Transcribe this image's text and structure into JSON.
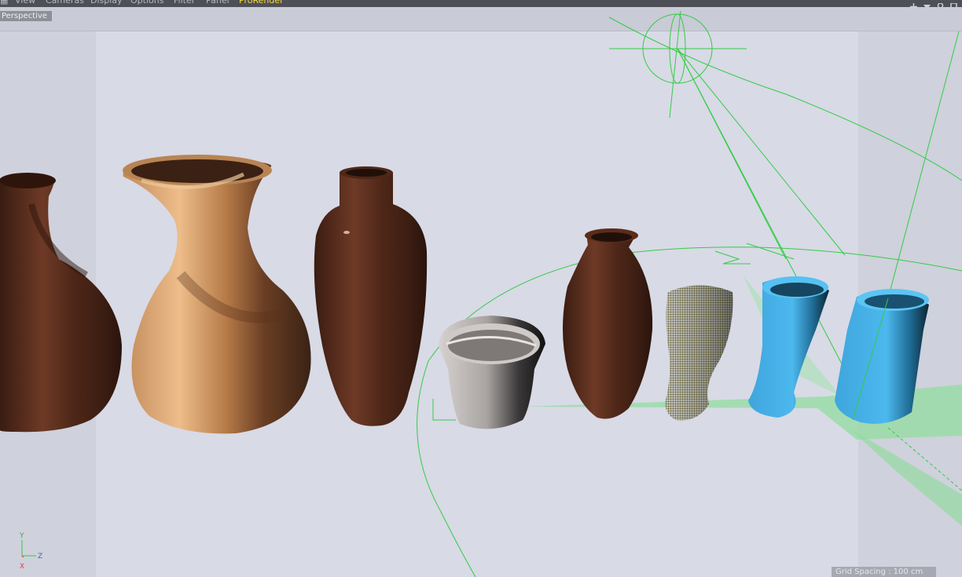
{
  "menubar": {
    "items": [
      {
        "label": "View"
      },
      {
        "label": "Cameras"
      },
      {
        "label": "Display"
      },
      {
        "label": "Options"
      },
      {
        "label": "Filter"
      },
      {
        "label": "Panel"
      },
      {
        "label": "ProRender"
      }
    ],
    "active_item": "ProRender",
    "active_color": "#f2dc3c",
    "nav_icons": [
      "move-view-icon",
      "zoom-view-icon",
      "rotate-view-icon",
      "toggle-view-icon"
    ]
  },
  "viewport": {
    "view_label": "Perspective",
    "grid_spacing": "Grid Spacing : 100 cm",
    "background_color": "#d8dae6",
    "selection_color": "#33cc44"
  },
  "axis": {
    "y": "Y",
    "z": "Z",
    "x": "X"
  },
  "scene": {
    "objects": [
      {
        "name": "wooden-vase-dark",
        "material": "dark-wood"
      },
      {
        "name": "wooden-vase-light",
        "material": "light-wood"
      },
      {
        "name": "wooden-bottle",
        "material": "dark-wood"
      },
      {
        "name": "flower-pot",
        "material": "rough-stone"
      },
      {
        "name": "wooden-vase-small",
        "material": "dark-wood"
      },
      {
        "name": "dotted-glass",
        "material": "olive-dotted"
      },
      {
        "name": "blue-flared-glass",
        "material": "blue-plastic"
      },
      {
        "name": "blue-cup",
        "material": "blue-plastic"
      }
    ],
    "light_helper": "sun-light-gizmo"
  }
}
